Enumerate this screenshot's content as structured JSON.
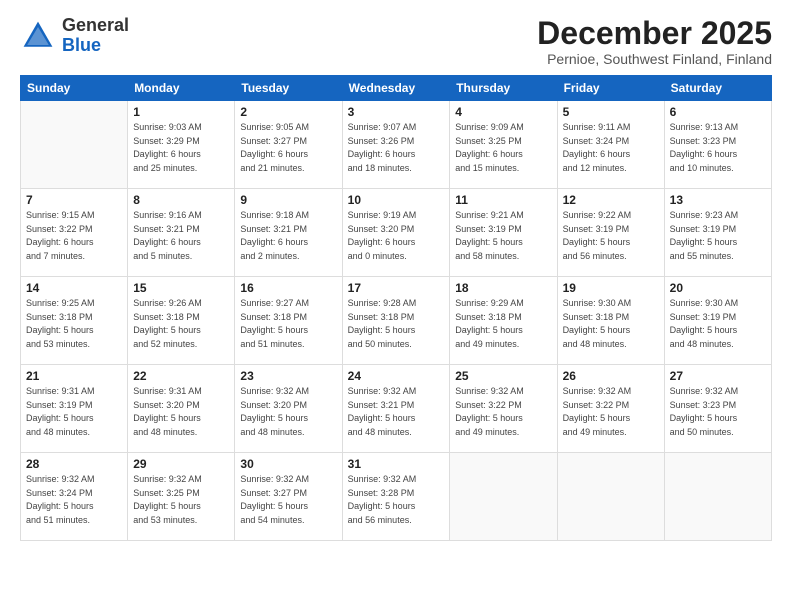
{
  "logo": {
    "general": "General",
    "blue": "Blue"
  },
  "header": {
    "title": "December 2025",
    "subtitle": "Pernioe, Southwest Finland, Finland"
  },
  "weekdays": [
    "Sunday",
    "Monday",
    "Tuesday",
    "Wednesday",
    "Thursday",
    "Friday",
    "Saturday"
  ],
  "weeks": [
    [
      {
        "day": "",
        "info": ""
      },
      {
        "day": "1",
        "info": "Sunrise: 9:03 AM\nSunset: 3:29 PM\nDaylight: 6 hours\nand 25 minutes."
      },
      {
        "day": "2",
        "info": "Sunrise: 9:05 AM\nSunset: 3:27 PM\nDaylight: 6 hours\nand 21 minutes."
      },
      {
        "day": "3",
        "info": "Sunrise: 9:07 AM\nSunset: 3:26 PM\nDaylight: 6 hours\nand 18 minutes."
      },
      {
        "day": "4",
        "info": "Sunrise: 9:09 AM\nSunset: 3:25 PM\nDaylight: 6 hours\nand 15 minutes."
      },
      {
        "day": "5",
        "info": "Sunrise: 9:11 AM\nSunset: 3:24 PM\nDaylight: 6 hours\nand 12 minutes."
      },
      {
        "day": "6",
        "info": "Sunrise: 9:13 AM\nSunset: 3:23 PM\nDaylight: 6 hours\nand 10 minutes."
      }
    ],
    [
      {
        "day": "7",
        "info": "Sunrise: 9:15 AM\nSunset: 3:22 PM\nDaylight: 6 hours\nand 7 minutes."
      },
      {
        "day": "8",
        "info": "Sunrise: 9:16 AM\nSunset: 3:21 PM\nDaylight: 6 hours\nand 5 minutes."
      },
      {
        "day": "9",
        "info": "Sunrise: 9:18 AM\nSunset: 3:21 PM\nDaylight: 6 hours\nand 2 minutes."
      },
      {
        "day": "10",
        "info": "Sunrise: 9:19 AM\nSunset: 3:20 PM\nDaylight: 6 hours\nand 0 minutes."
      },
      {
        "day": "11",
        "info": "Sunrise: 9:21 AM\nSunset: 3:19 PM\nDaylight: 5 hours\nand 58 minutes."
      },
      {
        "day": "12",
        "info": "Sunrise: 9:22 AM\nSunset: 3:19 PM\nDaylight: 5 hours\nand 56 minutes."
      },
      {
        "day": "13",
        "info": "Sunrise: 9:23 AM\nSunset: 3:19 PM\nDaylight: 5 hours\nand 55 minutes."
      }
    ],
    [
      {
        "day": "14",
        "info": "Sunrise: 9:25 AM\nSunset: 3:18 PM\nDaylight: 5 hours\nand 53 minutes."
      },
      {
        "day": "15",
        "info": "Sunrise: 9:26 AM\nSunset: 3:18 PM\nDaylight: 5 hours\nand 52 minutes."
      },
      {
        "day": "16",
        "info": "Sunrise: 9:27 AM\nSunset: 3:18 PM\nDaylight: 5 hours\nand 51 minutes."
      },
      {
        "day": "17",
        "info": "Sunrise: 9:28 AM\nSunset: 3:18 PM\nDaylight: 5 hours\nand 50 minutes."
      },
      {
        "day": "18",
        "info": "Sunrise: 9:29 AM\nSunset: 3:18 PM\nDaylight: 5 hours\nand 49 minutes."
      },
      {
        "day": "19",
        "info": "Sunrise: 9:30 AM\nSunset: 3:18 PM\nDaylight: 5 hours\nand 48 minutes."
      },
      {
        "day": "20",
        "info": "Sunrise: 9:30 AM\nSunset: 3:19 PM\nDaylight: 5 hours\nand 48 minutes."
      }
    ],
    [
      {
        "day": "21",
        "info": "Sunrise: 9:31 AM\nSunset: 3:19 PM\nDaylight: 5 hours\nand 48 minutes."
      },
      {
        "day": "22",
        "info": "Sunrise: 9:31 AM\nSunset: 3:20 PM\nDaylight: 5 hours\nand 48 minutes."
      },
      {
        "day": "23",
        "info": "Sunrise: 9:32 AM\nSunset: 3:20 PM\nDaylight: 5 hours\nand 48 minutes."
      },
      {
        "day": "24",
        "info": "Sunrise: 9:32 AM\nSunset: 3:21 PM\nDaylight: 5 hours\nand 48 minutes."
      },
      {
        "day": "25",
        "info": "Sunrise: 9:32 AM\nSunset: 3:22 PM\nDaylight: 5 hours\nand 49 minutes."
      },
      {
        "day": "26",
        "info": "Sunrise: 9:32 AM\nSunset: 3:22 PM\nDaylight: 5 hours\nand 49 minutes."
      },
      {
        "day": "27",
        "info": "Sunrise: 9:32 AM\nSunset: 3:23 PM\nDaylight: 5 hours\nand 50 minutes."
      }
    ],
    [
      {
        "day": "28",
        "info": "Sunrise: 9:32 AM\nSunset: 3:24 PM\nDaylight: 5 hours\nand 51 minutes."
      },
      {
        "day": "29",
        "info": "Sunrise: 9:32 AM\nSunset: 3:25 PM\nDaylight: 5 hours\nand 53 minutes."
      },
      {
        "day": "30",
        "info": "Sunrise: 9:32 AM\nSunset: 3:27 PM\nDaylight: 5 hours\nand 54 minutes."
      },
      {
        "day": "31",
        "info": "Sunrise: 9:32 AM\nSunset: 3:28 PM\nDaylight: 5 hours\nand 56 minutes."
      },
      {
        "day": "",
        "info": ""
      },
      {
        "day": "",
        "info": ""
      },
      {
        "day": "",
        "info": ""
      }
    ]
  ]
}
